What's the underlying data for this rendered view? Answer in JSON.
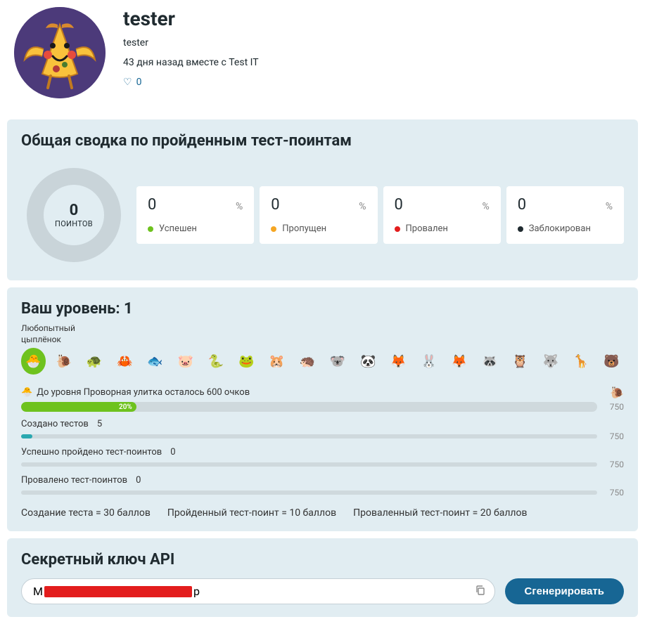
{
  "profile": {
    "display_name": "tester",
    "username": "tester",
    "tenure": "43 дня назад вместе с Test IT",
    "likes": "0"
  },
  "summary": {
    "title": "Общая сводка по пройденным тест-поинтам",
    "ring_value": "0",
    "ring_label": "ПОИНТОВ",
    "stats": [
      {
        "value": "0",
        "pct": "%",
        "label": "Успешен",
        "color": "#6ec21e"
      },
      {
        "value": "0",
        "pct": "%",
        "label": "Пропущен",
        "color": "#f5a623"
      },
      {
        "value": "0",
        "pct": "%",
        "label": "Провален",
        "color": "#e31d1d"
      },
      {
        "value": "0",
        "pct": "%",
        "label": "Заблокирован",
        "color": "#202b30"
      }
    ]
  },
  "level": {
    "title": "Ваш уровень: 1",
    "current_name_line1": "Любопытный",
    "current_name_line2": "цыплёнок",
    "badges": [
      "🐣",
      "🐌",
      "🐢",
      "🦀",
      "🐟",
      "🐷",
      "🐍",
      "🐸",
      "🐹",
      "🦔",
      "🐨",
      "🐼",
      "🦊",
      "🐰",
      "🦊",
      "🦝",
      "🦉",
      "🐺",
      "🦒",
      "🐻"
    ],
    "next_level_text": "До уровня Проворная улитка осталось 600 очков",
    "next_icon_left": "🐣",
    "next_icon_right": "🐌",
    "progress_pct": "20%",
    "progress_max": "750",
    "rows": [
      {
        "label": "Создано тестов",
        "value": "5",
        "max": "750",
        "fill": 2
      },
      {
        "label": "Успешно пройдено тест-поинтов",
        "value": "0",
        "max": "750",
        "fill": 0
      },
      {
        "label": "Провалено тест-поинтов",
        "value": "0",
        "max": "750",
        "fill": 0
      }
    ],
    "key": [
      "Создание теста = 30 баллов",
      "Пройденный тест-поинт = 10 баллов",
      "Проваленный тест-поинт = 20 баллов"
    ]
  },
  "api": {
    "title": "Секретный ключ API",
    "prefix": "M",
    "suffix": "p",
    "generate": "Сгенерировать"
  }
}
